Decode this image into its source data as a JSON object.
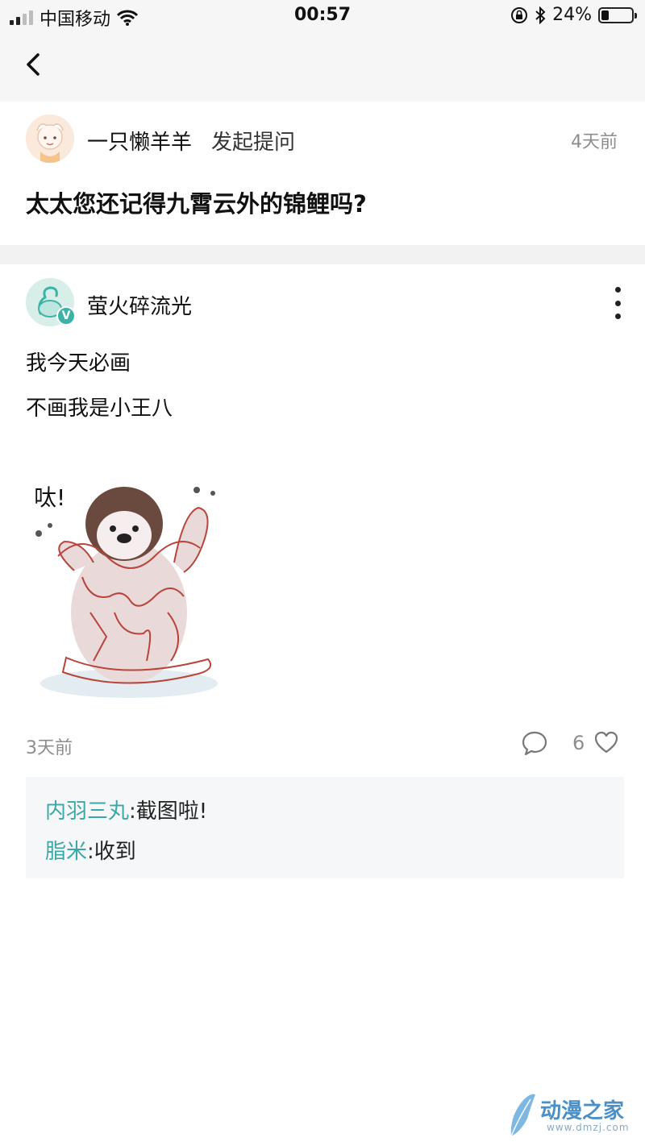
{
  "status_bar": {
    "carrier": "中国移动",
    "time": "00:57",
    "battery_percent": "24%",
    "battery_level": 0.24,
    "icons": [
      "signal-icon",
      "wifi-icon",
      "orientation-lock-icon",
      "bluetooth-icon",
      "battery-icon"
    ]
  },
  "nav": {
    "back_icon": "chevron-left-icon"
  },
  "question": {
    "author": "一只懒羊羊",
    "action": "发起提问",
    "time": "4天前",
    "title": "太太您还记得九霄云外的锦鲤吗?"
  },
  "answer": {
    "author": "萤火碎流光",
    "badge": "V",
    "lines": [
      "我今天必画",
      "不画我是小王八"
    ],
    "sticker_text": "呔!",
    "time": "3天前",
    "like_count": "6",
    "icons": [
      "comment-icon",
      "heart-icon",
      "more-icon"
    ]
  },
  "replies": [
    {
      "author": "内羽三丸",
      "colon": ":",
      "text": "截图啦!"
    },
    {
      "author": "脂米",
      "colon": ":",
      "text": "收到"
    }
  ],
  "watermark": {
    "text": "动漫之家",
    "url": "www.dmzj.com"
  },
  "colors": {
    "accent": "#3aa8a6",
    "muted_text": "#8d8d8d",
    "background_gray": "#f6f6f6"
  }
}
